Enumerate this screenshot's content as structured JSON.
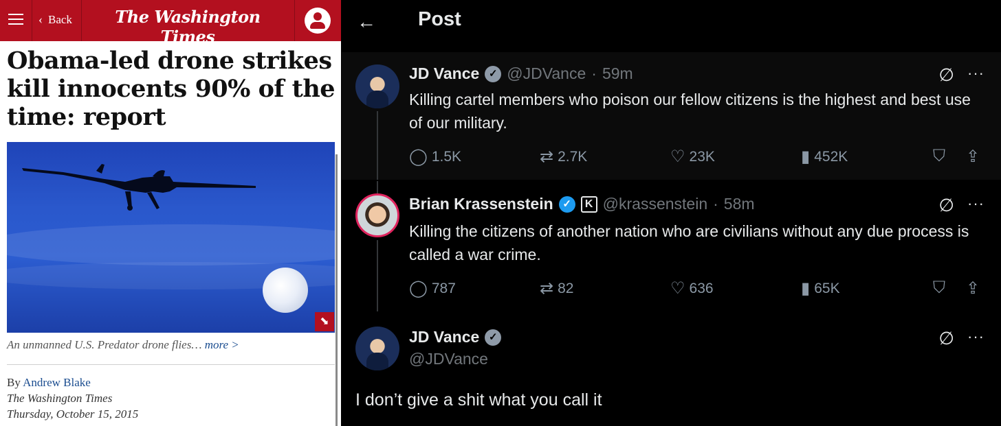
{
  "left": {
    "header": {
      "back_label": "Back",
      "logo_text": "The Washington Times",
      "brand_color": "#b3101f"
    },
    "headline": "Obama-led drone strikes kill innocents 90% of the time: report",
    "image": {
      "caption": "An unmanned U.S. Predator drone flies…",
      "more_label": "more >"
    },
    "byline": {
      "prefix": "By",
      "author": "Andrew Blake",
      "publication": "The Washington Times",
      "date": "Thursday, October 15, 2015"
    }
  },
  "right": {
    "title": "Post",
    "tweets": [
      {
        "name": "JD Vance",
        "handle": "@JDVance",
        "time": "59m",
        "text": "Killing cartel members who poison our fellow citizens is the highest and best use of our military.",
        "replies": "1.5K",
        "reposts": "2.7K",
        "likes": "23K",
        "views": "452K"
      },
      {
        "name": "Brian Krassenstein",
        "handle": "@krassenstein",
        "time": "58m",
        "text": "Killing the citizens of another nation who are civilians without any due process is called a war crime.",
        "replies": "787",
        "reposts": "82",
        "likes": "636",
        "views": "65K"
      },
      {
        "name": "JD Vance",
        "handle": "@JDVance",
        "text": "I don’t give a shit what you call it"
      }
    ],
    "icons": {
      "back": "arrow-left-icon",
      "grok": "grok-icon",
      "more": "more-icon",
      "reply": "reply-icon",
      "repost": "repost-icon",
      "like": "heart-icon",
      "views": "views-icon",
      "bookmark": "bookmark-icon",
      "share": "share-icon"
    }
  }
}
